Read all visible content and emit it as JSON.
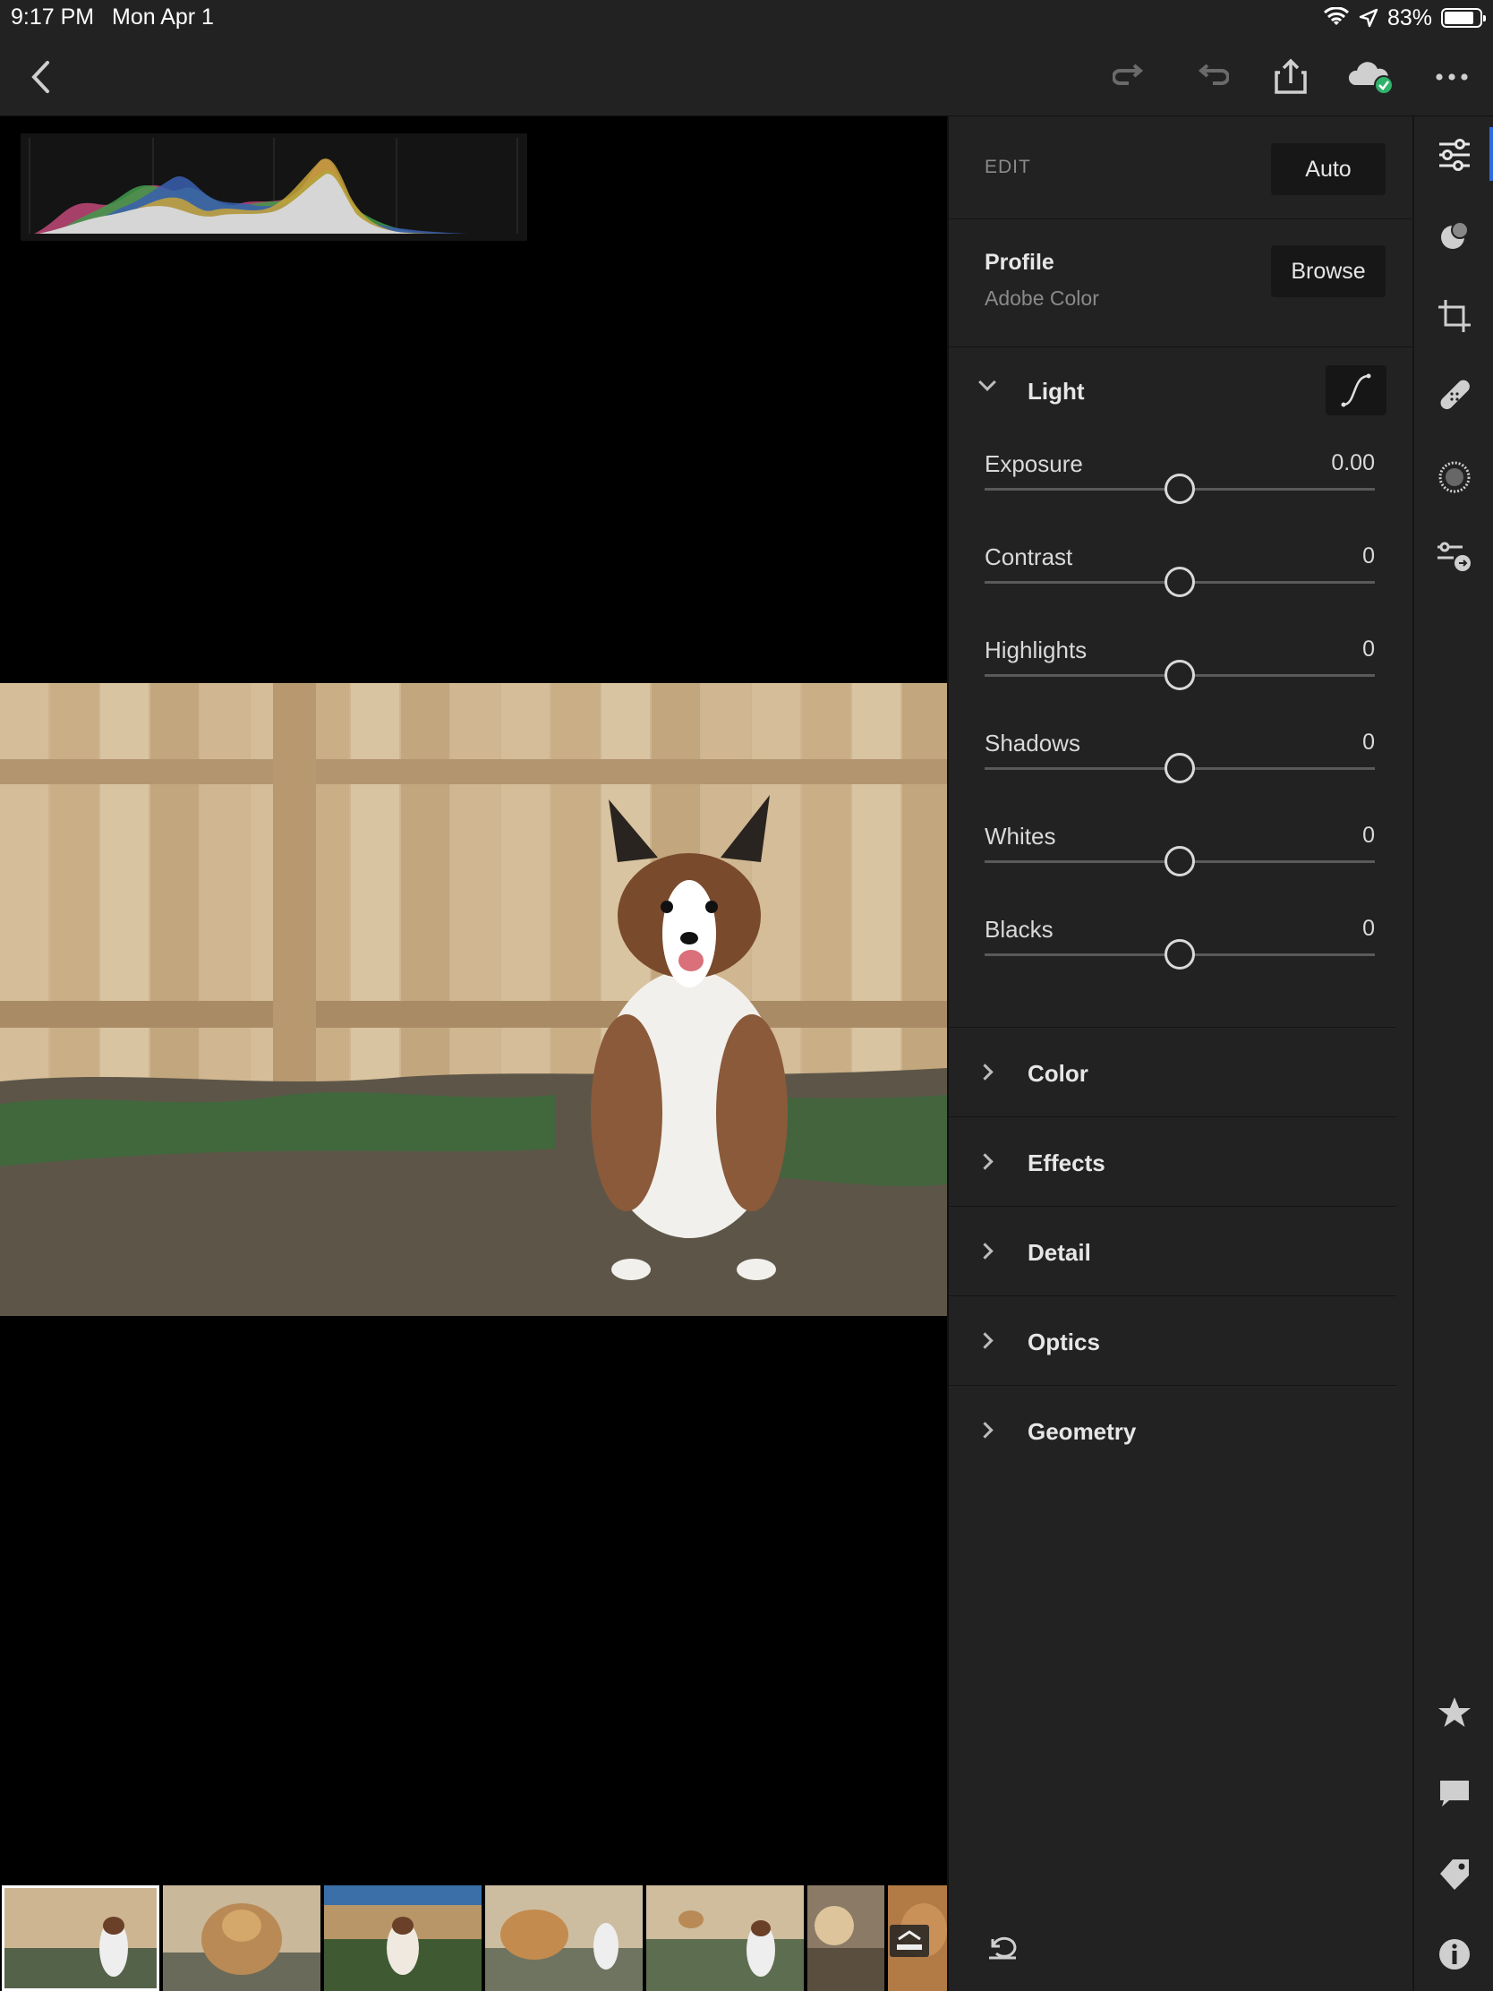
{
  "status_bar": {
    "time": "9:17 PM",
    "date": "Mon Apr 1",
    "battery_percent": "83%",
    "battery_level": 0.83
  },
  "toolbar": {
    "icons": [
      "back-icon",
      "redo-icon",
      "undo-icon",
      "share-icon",
      "cloud-synced-icon",
      "more-icon"
    ]
  },
  "panel": {
    "edit_label": "EDIT",
    "auto_label": "Auto",
    "profile": {
      "title": "Profile",
      "value": "Adobe Color",
      "browse_label": "Browse"
    },
    "light": {
      "title": "Light",
      "sliders": [
        {
          "label": "Exposure",
          "value": "0.00"
        },
        {
          "label": "Contrast",
          "value": "0"
        },
        {
          "label": "Highlights",
          "value": "0"
        },
        {
          "label": "Shadows",
          "value": "0"
        },
        {
          "label": "Whites",
          "value": "0"
        },
        {
          "label": "Blacks",
          "value": "0"
        }
      ]
    },
    "sections": [
      "Color",
      "Effects",
      "Detail",
      "Optics",
      "Geometry"
    ]
  },
  "rail": {
    "top_icons": [
      "edit-sliders-icon",
      "selective-icon",
      "crop-icon",
      "healing-icon",
      "vignette-icon",
      "presets-icon"
    ],
    "bottom_icons": [
      "star-icon",
      "comment-icon",
      "tag-icon",
      "info-icon"
    ]
  },
  "filmstrip": {
    "count_visible": 7,
    "selected_index": 0
  },
  "colors": {
    "panel_bg": "#222222",
    "accent": "#2d6cdf",
    "cloud_badge": "#2fb36a"
  }
}
